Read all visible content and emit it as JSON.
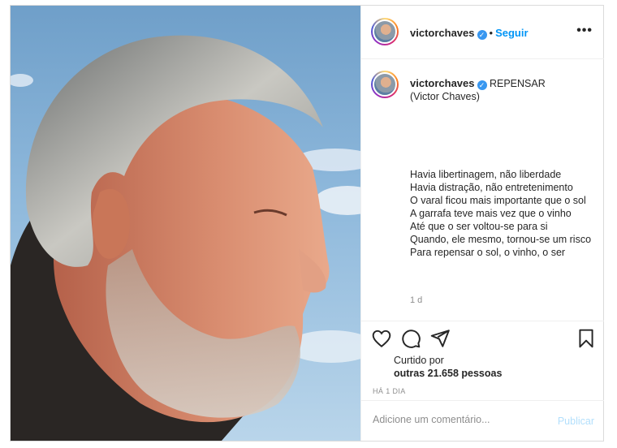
{
  "post": {
    "header": {
      "username": "victorchaves",
      "separator": "•",
      "follow_label": "Seguir",
      "more_label": "•••"
    },
    "caption": {
      "username": "victorchaves",
      "title": "REPENSAR",
      "author": "(Victor Chaves)",
      "lines": [
        "Havia libertinagem, não liberdade",
        "Havia distração, não entretenimento",
        "O varal ficou mais importante que o sol",
        "A garrafa teve mais vez que o vinho",
        "Até que o ser voltou-se para si",
        "Quando, ele mesmo, tornou-se um risco",
        "Para repensar o sol, o vinho, o ser"
      ],
      "age": "1 d"
    },
    "likes": {
      "label": "Curtido por",
      "count_text": "outras 21.658 pessoas"
    },
    "timestamp": "HÁ 1 DIA",
    "comment": {
      "placeholder": "Adicione um comentário...",
      "publish_label": "Publicar"
    }
  },
  "colors": {
    "accent": "#0095f6",
    "publish_disabled": "#b2dffc",
    "verified": "#3897f0",
    "muted_text": "#8e8e8e",
    "border": "#dbdbdb"
  },
  "icons": {
    "verified": "verified-badge-icon",
    "like": "heart-icon",
    "comment": "comment-bubble-icon",
    "share": "paper-plane-icon",
    "save": "bookmark-icon",
    "more": "more-options-icon"
  }
}
